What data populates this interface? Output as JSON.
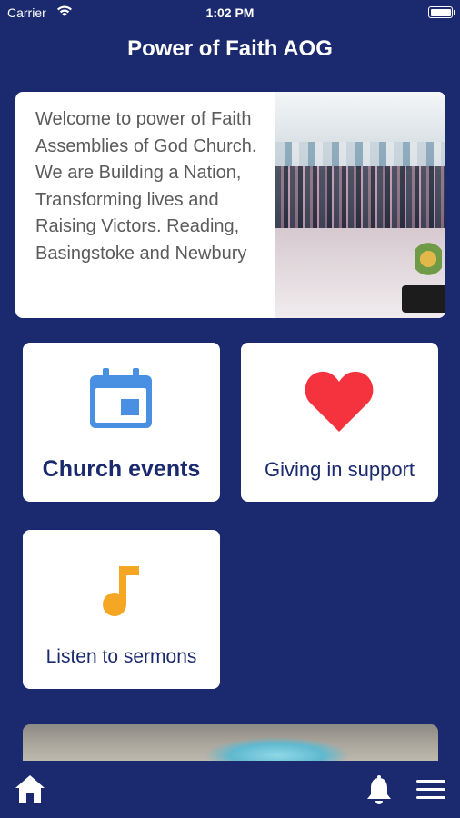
{
  "status_bar": {
    "carrier": "Carrier",
    "time": "1:02 PM",
    "wifi_icon": "wifi-icon",
    "battery_icon": "battery-icon"
  },
  "header": {
    "title": "Power of Faith AOG"
  },
  "welcome": {
    "text": "Welcome to power of Faith Assemblies of God Church. We are Building a Nation, Transforming lives and Raising Victors. Reading, Basingstoke and Newbury"
  },
  "tiles": [
    {
      "label": "Church events",
      "icon": "calendar-icon",
      "icon_color": "#4a90e2"
    },
    {
      "label": "Giving in support",
      "icon": "heart-icon",
      "icon_color": "#f4333f"
    },
    {
      "label": "Listen to sermons",
      "icon": "music-note-icon",
      "icon_color": "#f5a623"
    }
  ],
  "tab_bar": {
    "home_icon": "home-icon",
    "notifications_icon": "bell-icon",
    "menu_icon": "hamburger-menu-icon"
  },
  "colors": {
    "background": "#1b2a6e",
    "card": "#ffffff",
    "text_dark_blue": "#1b2a6e",
    "body_text": "#5b5b5b"
  }
}
